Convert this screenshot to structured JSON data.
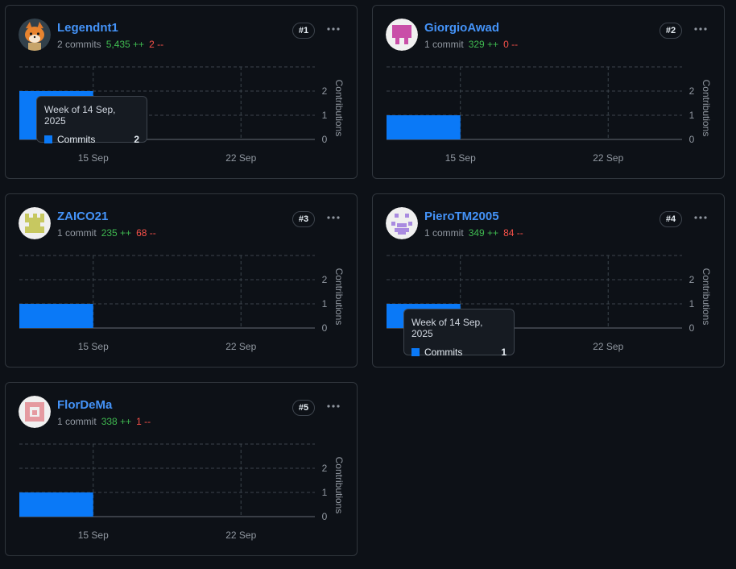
{
  "colors": {
    "accent": "#4493f8",
    "bar": "#0a79f7",
    "additions": "#3fb950",
    "deletions": "#f85149",
    "background": "#0d1117",
    "border": "#30363d"
  },
  "contributors": [
    {
      "username": "Legendnt1",
      "commits_text": "2 commits",
      "additions_text": "5,435 ++",
      "deletions_text": "2 --",
      "rank": "#1",
      "avatar": "fox-avatar",
      "more_icon": "kebab-horizontal-icon",
      "tooltip": {
        "visible": true,
        "title": "Week of 14 Sep, 2025",
        "label": "Commits",
        "value": "2"
      }
    },
    {
      "username": "GiorgioAwad",
      "commits_text": "1 commit",
      "additions_text": "329 ++",
      "deletions_text": "0 --",
      "rank": "#2",
      "avatar": "identicon-magenta",
      "more_icon": "kebab-horizontal-icon",
      "tooltip": {
        "visible": false
      }
    },
    {
      "username": "ZAICO21",
      "commits_text": "1 commit",
      "additions_text": "235 ++",
      "deletions_text": "68 --",
      "rank": "#3",
      "avatar": "identicon-olive",
      "more_icon": "kebab-horizontal-icon",
      "tooltip": {
        "visible": false
      }
    },
    {
      "username": "PieroTM2005",
      "commits_text": "1 commit",
      "additions_text": "349 ++",
      "deletions_text": "84 --",
      "rank": "#4",
      "avatar": "identicon-purple",
      "more_icon": "kebab-horizontal-icon",
      "tooltip": {
        "visible": true,
        "title": "Week of 14 Sep, 2025",
        "label": "Commits",
        "value": "1"
      }
    },
    {
      "username": "FlorDeMa",
      "commits_text": "1 commit",
      "additions_text": "338 ++",
      "deletions_text": "1 --",
      "rank": "#5",
      "avatar": "identicon-pink",
      "more_icon": "kebab-horizontal-icon",
      "tooltip": {
        "visible": false
      }
    }
  ],
  "chart_data": [
    {
      "type": "bar",
      "categories": [
        "15 Sep",
        "22 Sep"
      ],
      "series": [
        {
          "name": "Commits",
          "values": [
            2,
            0
          ]
        }
      ],
      "ylabel": "Contributions",
      "yticks": [
        "0",
        "1",
        "2"
      ],
      "ylim": [
        0,
        3
      ],
      "grid": true
    },
    {
      "type": "bar",
      "categories": [
        "15 Sep",
        "22 Sep"
      ],
      "series": [
        {
          "name": "Commits",
          "values": [
            1,
            0
          ]
        }
      ],
      "ylabel": "Contributions",
      "yticks": [
        "0",
        "1",
        "2"
      ],
      "ylim": [
        0,
        3
      ],
      "grid": true
    },
    {
      "type": "bar",
      "categories": [
        "15 Sep",
        "22 Sep"
      ],
      "series": [
        {
          "name": "Commits",
          "values": [
            1,
            0
          ]
        }
      ],
      "ylabel": "Contributions",
      "yticks": [
        "0",
        "1",
        "2"
      ],
      "ylim": [
        0,
        3
      ],
      "grid": true
    },
    {
      "type": "bar",
      "categories": [
        "15 Sep",
        "22 Sep"
      ],
      "series": [
        {
          "name": "Commits",
          "values": [
            1,
            0
          ]
        }
      ],
      "ylabel": "Contributions",
      "yticks": [
        "0",
        "1",
        "2"
      ],
      "ylim": [
        0,
        3
      ],
      "grid": true
    },
    {
      "type": "bar",
      "categories": [
        "15 Sep",
        "22 Sep"
      ],
      "series": [
        {
          "name": "Commits",
          "values": [
            1,
            0
          ]
        }
      ],
      "ylabel": "Contributions",
      "yticks": [
        "0",
        "1",
        "2"
      ],
      "ylim": [
        0,
        3
      ],
      "grid": true
    }
  ]
}
